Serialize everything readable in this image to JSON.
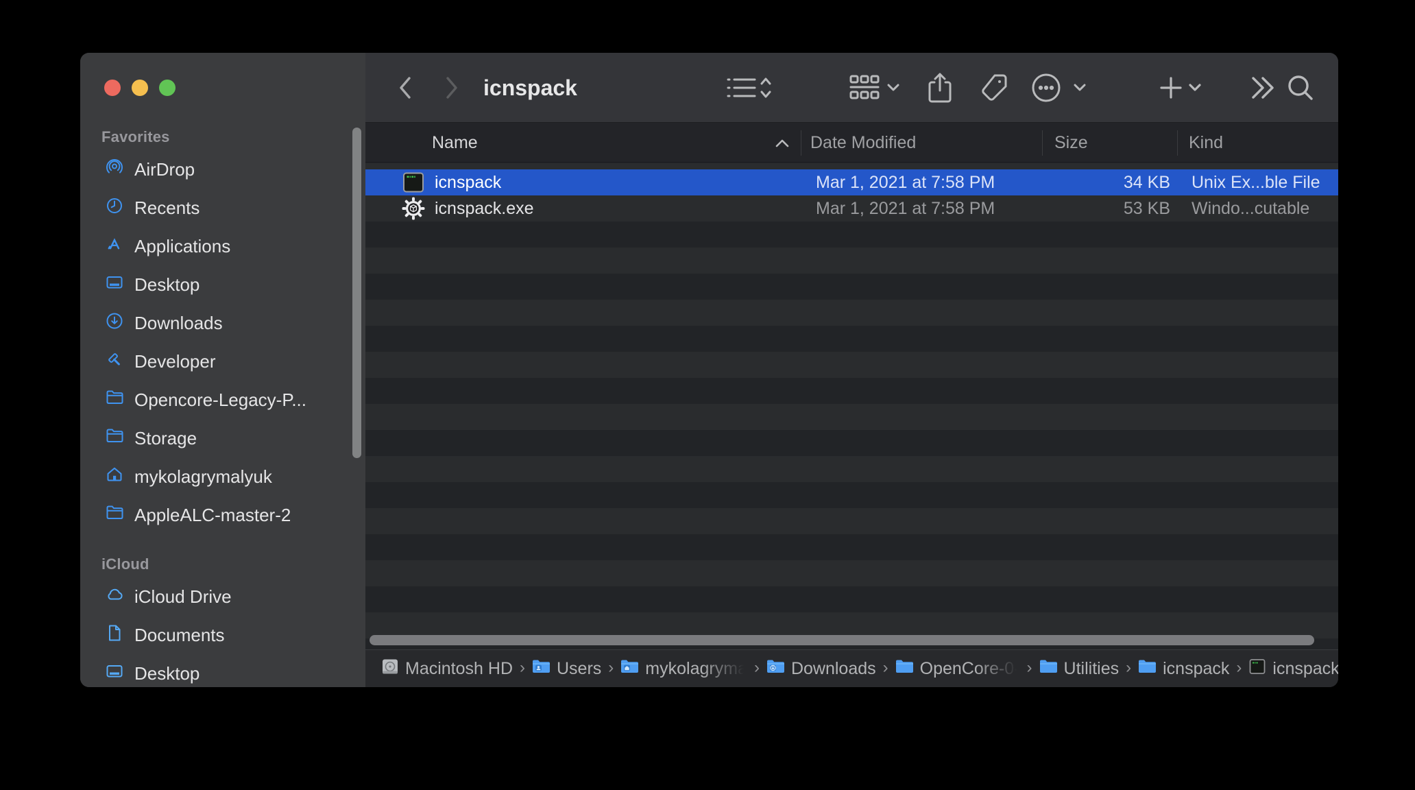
{
  "window": {
    "title": "icnspack"
  },
  "traffic_lights": {
    "close": "close-button",
    "minimize": "minimize-button",
    "zoom": "zoom-button"
  },
  "sidebar": {
    "sections": [
      {
        "label": "Favorites",
        "items": [
          {
            "label": "AirDrop",
            "icon": "airdrop-icon"
          },
          {
            "label": "Recents",
            "icon": "clock-icon"
          },
          {
            "label": "Applications",
            "icon": "app-store-icon"
          },
          {
            "label": "Desktop",
            "icon": "desktop-icon"
          },
          {
            "label": "Downloads",
            "icon": "download-circle-icon"
          },
          {
            "label": "Developer",
            "icon": "hammer-icon"
          },
          {
            "label": "Opencore-Legacy-P...",
            "icon": "folder-icon"
          },
          {
            "label": "Storage",
            "icon": "folder-icon"
          },
          {
            "label": "mykolagrymalyuk",
            "icon": "home-icon"
          },
          {
            "label": "AppleALC-master-2",
            "icon": "folder-icon"
          }
        ]
      },
      {
        "label": "iCloud",
        "items": [
          {
            "label": "iCloud Drive",
            "icon": "cloud-icon"
          },
          {
            "label": "Documents",
            "icon": "document-icon"
          },
          {
            "label": "Desktop",
            "icon": "desktop-icon"
          }
        ]
      }
    ]
  },
  "toolbar": {
    "buttons": [
      "back",
      "forward",
      "list-view",
      "group-by",
      "share",
      "tag",
      "more-options",
      "new-item",
      "show-more",
      "search"
    ]
  },
  "table": {
    "columns": [
      {
        "label": "Name",
        "sort": "asc"
      },
      {
        "label": "Date Modified"
      },
      {
        "label": "Size"
      },
      {
        "label": "Kind"
      }
    ],
    "rows": [
      {
        "name": "icnspack",
        "date_modified": "Mar 1, 2021 at 7:58 PM",
        "size": "34 KB",
        "kind": "Unix Ex...ble File",
        "icon": "unix-executable-icon",
        "selected": true
      },
      {
        "name": "icnspack.exe",
        "date_modified": "Mar 1, 2021 at 7:58 PM",
        "size": "53 KB",
        "kind": "Windo...cutable",
        "icon": "windows-executable-icon",
        "selected": false
      }
    ]
  },
  "pathbar": {
    "items": [
      {
        "label": "Macintosh HD",
        "icon": "hard-drive-icon"
      },
      {
        "label": "Users",
        "icon": "folder-users-icon"
      },
      {
        "label": "mykolagryma",
        "icon": "folder-home-icon",
        "truncated": true
      },
      {
        "label": "Downloads",
        "icon": "folder-downloads-icon"
      },
      {
        "label": "OpenCore-0-",
        "icon": "folder-icon",
        "truncated": true
      },
      {
        "label": "Utilities",
        "icon": "folder-icon"
      },
      {
        "label": "icnspack",
        "icon": "folder-icon"
      },
      {
        "label": "icnspack",
        "icon": "unix-executable-icon"
      }
    ]
  },
  "colors": {
    "selection_blue": "#2457c9",
    "sidebar_accent_blue": "#3f93f0",
    "icloud_accent_blue": "#55a9f4",
    "sidebar_bg": "#3b3c3e",
    "toolbar_bg": "#343539",
    "stripe_dark": "#222427",
    "stripe_light": "#2a2c2e",
    "pathbar_bg": "#28292c",
    "folder_blue": "#4f9ef2"
  }
}
